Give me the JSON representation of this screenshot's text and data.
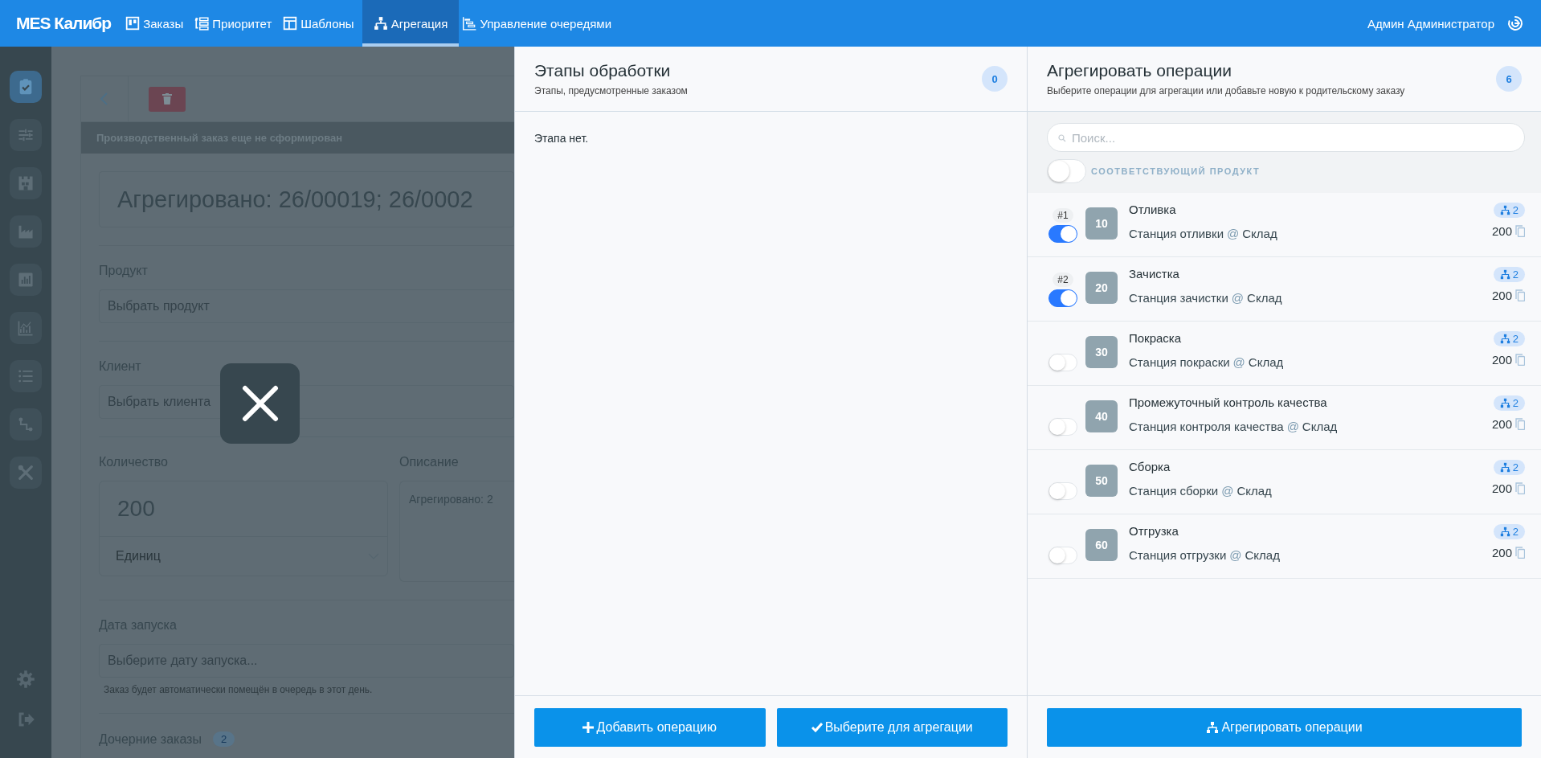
{
  "top_bar": {
    "logo": "MES Калибр",
    "nav": [
      {
        "label": "Заказы",
        "selected": false
      },
      {
        "label": "Приоритет",
        "selected": false
      },
      {
        "label": "Шаблоны",
        "selected": false
      },
      {
        "label": "Агрегация",
        "selected": true
      },
      {
        "label": "Управление очередями",
        "selected": false
      }
    ],
    "user": "Админ Администратор"
  },
  "sidebar": {
    "items": [
      {
        "selected": true
      },
      {
        "selected": false
      },
      {
        "selected": false
      },
      {
        "selected": false
      },
      {
        "selected": false
      },
      {
        "selected": false
      },
      {
        "selected": false
      },
      {
        "selected": false
      },
      {
        "selected": false
      }
    ]
  },
  "background_page": {
    "notice": "Производственный заказ еще не сформирован",
    "title_value": "Агрегировано: 26/00019; 26/0002",
    "product_label": "Продукт",
    "product_placeholder": "Выбрать продукт",
    "client_label": "Клиент",
    "client_placeholder": "Выбрать клиента",
    "quantity_label": "Количество",
    "quantity_value": "200",
    "unit_value": "Единиц",
    "description_label": "Описание",
    "description_value": "Агрегировано: 2",
    "date_label": "Дата запуска",
    "date_placeholder": "Выберите дату запуска...",
    "date_hint": "Заказ будет автоматически помещён в очередь в этот день.",
    "children_label": "Дочерние заказы",
    "children_count": "2"
  },
  "stages_panel": {
    "title": "Этапы обработки",
    "subtitle": "Этапы, предусмотренные заказом",
    "count": "0",
    "empty_text": "Этапа нет.",
    "buttons": [
      {
        "kind": "add",
        "label": "Добавить операцию"
      },
      {
        "kind": "select",
        "label": "Выберите для агрегации"
      }
    ]
  },
  "aggregate_panel": {
    "title": "Агрегировать операции",
    "subtitle": "Выберите операции для агрегации или добавьте новую к родительскому заказу",
    "count": "6",
    "search": {
      "placeholder": "Поиск..."
    },
    "filter": {
      "label": "СООТВЕТСТВУЮЩИЙ ПРОДУКТ",
      "on": false
    },
    "operations": [
      {
        "order": "#1",
        "selected": true,
        "number": "10",
        "name": "Отливка",
        "station": "Станция отливки",
        "at": "@",
        "site": "Склад",
        "links": "2",
        "quantity": "200"
      },
      {
        "order": "#2",
        "selected": true,
        "number": "20",
        "name": "Зачистка",
        "station": "Станция зачистки",
        "at": "@",
        "site": "Склад",
        "links": "2",
        "quantity": "200"
      },
      {
        "selected": false,
        "number": "30",
        "name": "Покраска",
        "station": "Станция покраски",
        "at": "@",
        "site": "Склад",
        "links": "2",
        "quantity": "200"
      },
      {
        "selected": false,
        "number": "40",
        "name": "Промежуточный контроль качества",
        "station": "Станция контроля качества",
        "at": "@",
        "site": "Склад",
        "links": "2",
        "quantity": "200"
      },
      {
        "selected": false,
        "number": "50",
        "name": "Сборка",
        "station": "Станция сборки",
        "at": "@",
        "site": "Склад",
        "links": "2",
        "quantity": "200"
      },
      {
        "selected": false,
        "number": "60",
        "name": "Отгрузка",
        "station": "Станция отгрузки",
        "at": "@",
        "site": "Склад",
        "links": "2",
        "quantity": "200"
      }
    ],
    "button": {
      "label": "Агрегировать операции"
    }
  }
}
